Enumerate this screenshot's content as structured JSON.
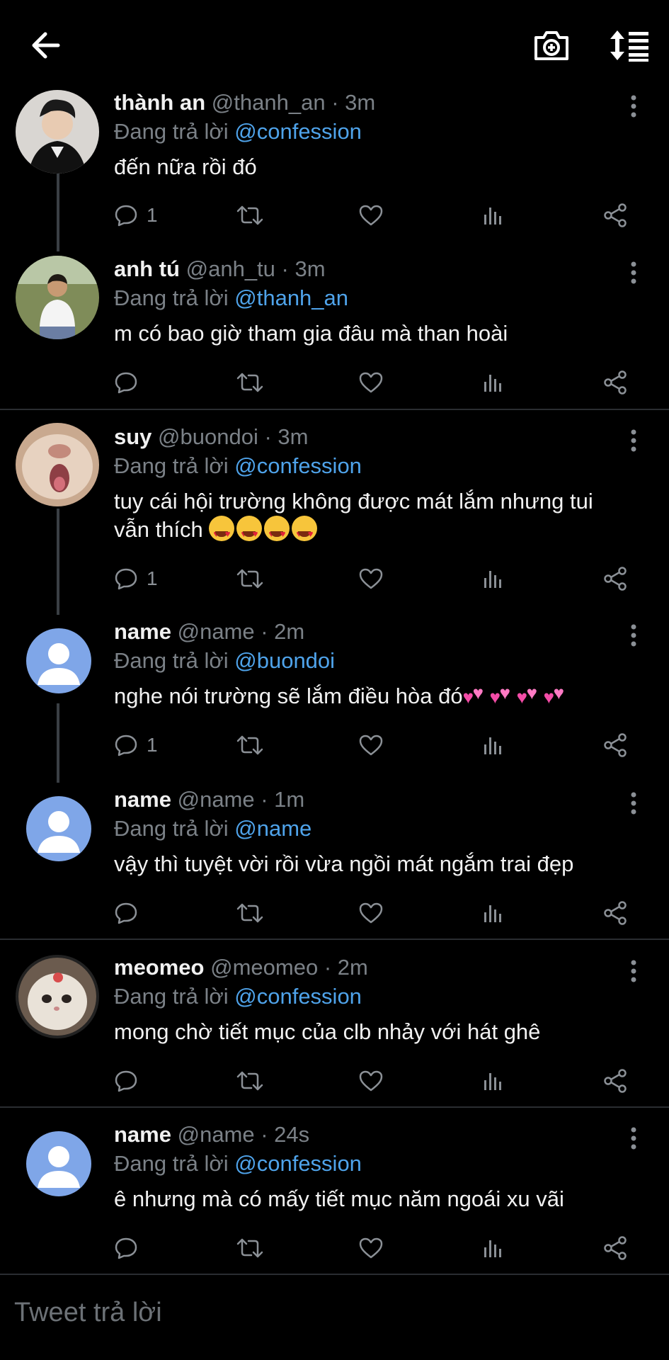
{
  "topbar": {
    "back_icon": "arrow-left-icon",
    "camera_icon": "camera-plus-icon",
    "sort_icon": "sort-icon"
  },
  "tweets": [
    {
      "name": "thành an",
      "handle": "@thanh_an",
      "time": "· 3m",
      "reply_prefix": "Đang trả lời",
      "mention": "@confession",
      "text": "đến nữa rồi đó",
      "replies": "1"
    },
    {
      "name": "anh tú",
      "handle": "@anh_tu",
      "time": "· 3m",
      "reply_prefix": "Đang trả lời",
      "mention": "@thanh_an",
      "text": "m có bao giờ tham gia đâu mà than hoài",
      "replies": ""
    },
    {
      "name": "suy",
      "handle": "@buondoi",
      "time": "· 3m",
      "reply_prefix": "Đang trả lời",
      "mention": "@confession",
      "text_line1": "tuy cái hội trường không được mát lắm nhưng tui",
      "text_line2": "vẫn thích",
      "replies": "1"
    },
    {
      "name": "name",
      "handle": "@name",
      "time": "· 2m",
      "reply_prefix": "Đang trả lời",
      "mention": "@buondoi",
      "text": "nghe nói trường sẽ lắm điều hòa đó",
      "replies": "1"
    },
    {
      "name": "name",
      "handle": "@name",
      "time": "· 1m",
      "reply_prefix": "Đang trả lời",
      "mention": "@name",
      "text": "vậy thì tuyệt vời rồi vừa ngồi mát ngắm trai đẹp",
      "replies": ""
    },
    {
      "name": "meomeo",
      "handle": "@meomeo",
      "time": "· 2m",
      "reply_prefix": "Đang trả lời",
      "mention": "@confession",
      "text": "mong chờ tiết mục của clb nhảy với hát ghê",
      "replies": ""
    },
    {
      "name": "name",
      "handle": "@name",
      "time": "· 24s",
      "reply_prefix": "Đang trả lời",
      "mention": "@confession",
      "text": "ê nhưng mà có mấy tiết mục năm ngoái xu vãi",
      "replies": ""
    }
  ],
  "composer": {
    "placeholder": "Tweet trả lời"
  },
  "colors": {
    "background": "#000000",
    "mention": "#4fa3ea",
    "muted": "#7b8187"
  }
}
